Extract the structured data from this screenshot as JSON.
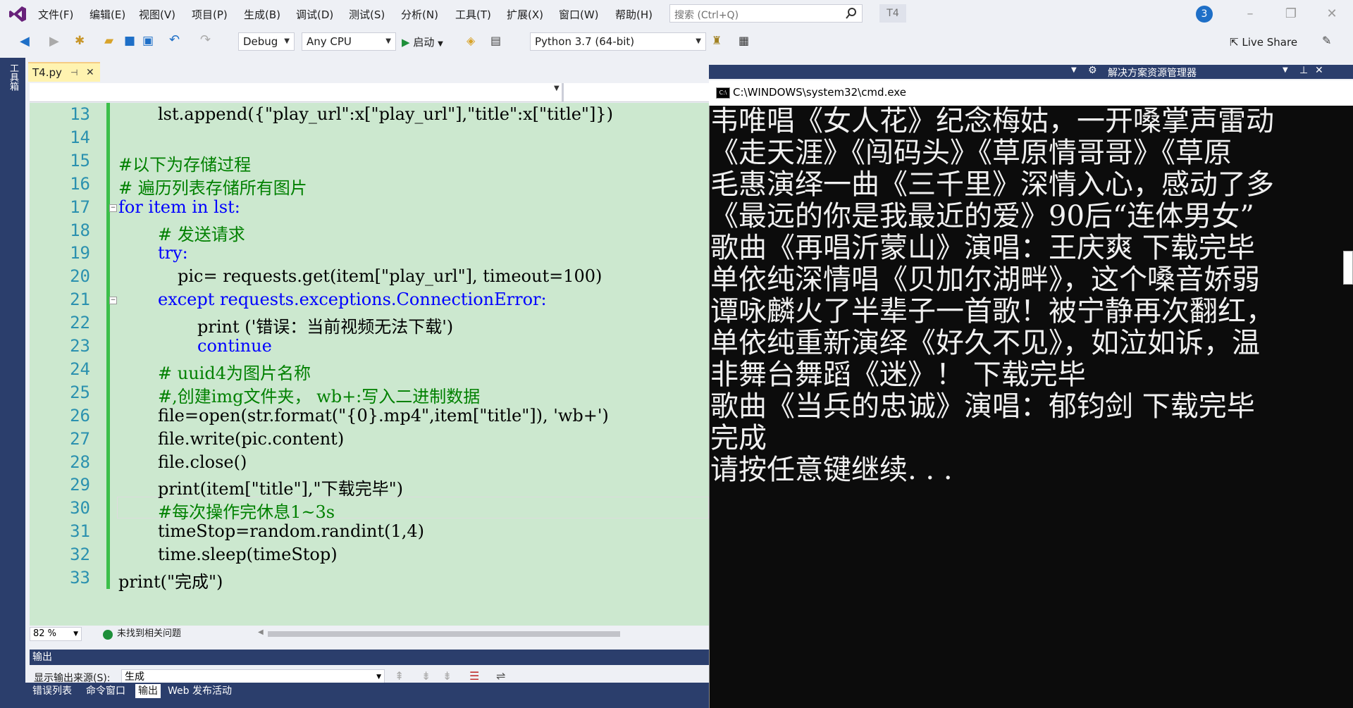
{
  "menu": [
    "文件(F)",
    "编辑(E)",
    "视图(V)",
    "项目(P)",
    "生成(B)",
    "调试(D)",
    "测试(S)",
    "分析(N)",
    "工具(T)",
    "扩展(X)",
    "窗口(W)",
    "帮助(H)"
  ],
  "search": {
    "placeholder": "搜索 (Ctrl+Q)"
  },
  "title_badge": "T4",
  "notifications": "3",
  "toolbar": {
    "config": "Debug",
    "platform": "Any CPU",
    "start": "启动",
    "python": "Python 3.7 (64-bit)",
    "live_share": "Live Share"
  },
  "toolbox_label": "工具箱",
  "editor": {
    "tab": "T4.py",
    "lines": [
      {
        "n": "13",
        "html": "lst.append({\"play_url\":x[\"play_url\"],\"title\":x[\"title\"]})"
      },
      {
        "n": "14",
        "html": ""
      },
      {
        "n": "15",
        "html": "#以下为存储过程"
      },
      {
        "n": "16",
        "html": "# 遍历列表存储所有图片"
      },
      {
        "n": "17",
        "html": "for item in lst:"
      },
      {
        "n": "18",
        "html": "# 发送请求"
      },
      {
        "n": "19",
        "html": "try:"
      },
      {
        "n": "20",
        "html": "pic= requests.get(item[\"play_url\"], timeout=100)"
      },
      {
        "n": "21",
        "html": "except requests.exceptions.ConnectionError:"
      },
      {
        "n": "22",
        "html": "print ('错误：当前视频无法下载')"
      },
      {
        "n": "23",
        "html": "continue"
      },
      {
        "n": "24",
        "html": "# uuid4为图片名称"
      },
      {
        "n": "25",
        "html": "#,创建img文件夹， wb+:写入二进制数据"
      },
      {
        "n": "26",
        "html": "file=open(str.format(\"{0}.mp4\",item[\"title\"]), 'wb+')"
      },
      {
        "n": "27",
        "html": "file.write(pic.content)"
      },
      {
        "n": "28",
        "html": "file.close()"
      },
      {
        "n": "29",
        "html": "print(item[\"title\"],\"下载完毕\")"
      },
      {
        "n": "30",
        "html": "#每次操作完休息1~3s"
      },
      {
        "n": "31",
        "html": "timeStop=random.randint(1,4)"
      },
      {
        "n": "32",
        "html": "time.sleep(timeStop)"
      },
      {
        "n": "33",
        "html": "print(\"完成\")"
      }
    ],
    "zoom": "82 %",
    "issues": "未找到相关问题"
  },
  "output": {
    "title": "输出",
    "source_label": "显示输出来源(S):",
    "source_value": "生成"
  },
  "bottom_tabs": [
    "错误列表",
    "命令窗口",
    "输出",
    "Web 发布活动"
  ],
  "solution_explorer": "解决方案资源管理器",
  "cmd": {
    "title": "C:\\WINDOWS\\system32\\cmd.exe",
    "lines": [
      "韦唯唱《女人花》纪念梅姑，一开嗓掌声雷动",
      "《走天涯》《闯码头》《草原情哥哥》《草原",
      "毛惠演绎一曲《三千里》深情入心，感动了多",
      "《最远的你是我最近的爱》90后“连体男女”",
      "歌曲《再唱沂蒙山》演唱：王庆爽 下载完毕",
      "单依纯深情唱《贝加尔湖畔》，这个嗓音娇弱",
      "谭咏麟火了半辈子一首歌！被宁静再次翻红，",
      "单依纯重新演绎《好久不见》，如泣如诉，温",
      "非舞台舞蹈《迷》！ 下载完毕",
      "歌曲《当兵的忠诚》演唱：郁钧剑 下载完毕",
      "完成",
      "请按任意键继续. . ."
    ]
  }
}
